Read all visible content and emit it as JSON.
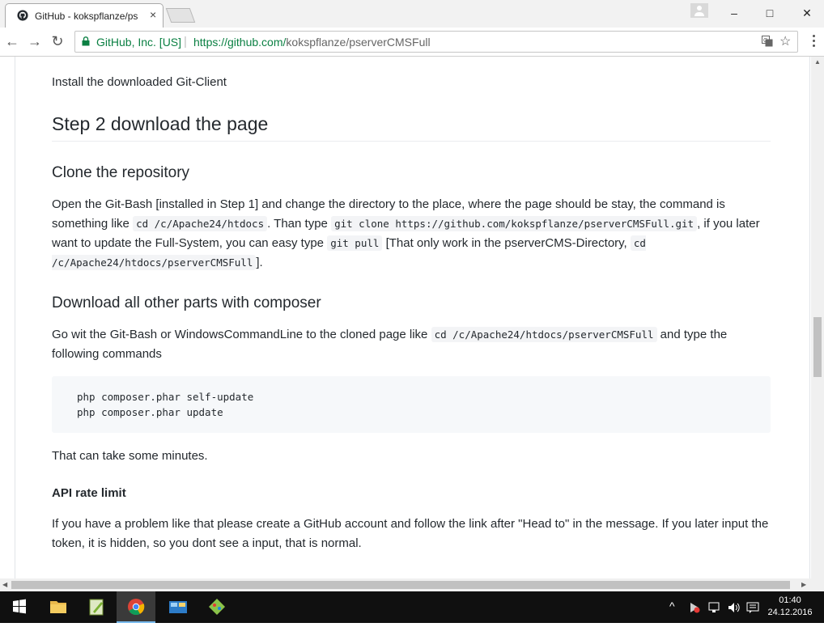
{
  "browser": {
    "tab_title": "GitHub - kokspflanze/ps",
    "tab_close": "×",
    "window_controls": {
      "minimize": "–",
      "maximize": "□",
      "close": "✕"
    },
    "nav": {
      "back": "←",
      "forward": "→",
      "reload": "↻"
    },
    "site_identity": "GitHub, Inc. [US]",
    "separator": "|",
    "url_scheme_host": "https://github.com/",
    "url_path": "kokspflanze/pserverCMSFull",
    "bookmark_star": "☆",
    "accent_color": "#0b8043"
  },
  "article": {
    "install_line": "Install the downloaded Git-Client",
    "step2_heading": "Step 2 download the page",
    "clone_heading": "Clone the repository",
    "clone_para": {
      "t1": "Open the Git-Bash [installed in Step 1] and change the directory to the place, where the page should be stay, the command is something like ",
      "c1": "cd /c/Apache24/htdocs",
      "t2": ". Than type ",
      "c2": "git clone https://github.com/kokspflanze/pserverCMSFull.git",
      "t3": ", if you later want to update the Full-System, you can easy type ",
      "c3": "git pull",
      "t4": " [That only work in the pserverCMS-Directory, ",
      "c4": "cd /c/Apache24/htdocs/pserverCMSFull",
      "t5": "]."
    },
    "composer_heading": "Download all other parts with composer",
    "composer_para": {
      "t1": "Go wit the Git-Bash or WindowsCommandLine to the cloned page like ",
      "c1": "cd /c/Apache24/htdocs/pserverCMSFull",
      "t2": " and type the following commands"
    },
    "code_lines": [
      "php composer.phar self-update",
      "php composer.phar update"
    ],
    "minutes_line": "That can take some minutes.",
    "api_heading": "API rate limit",
    "api_para": "If you have a problem like that please create a GitHub account and follow the link after \"Head to\" in the message. If you later input the token, it is hidden, so you dont see a input, that is normal."
  },
  "taskbar": {
    "tray_up": "^",
    "clock_time": "01:40",
    "clock_date": "24.12.2016"
  }
}
